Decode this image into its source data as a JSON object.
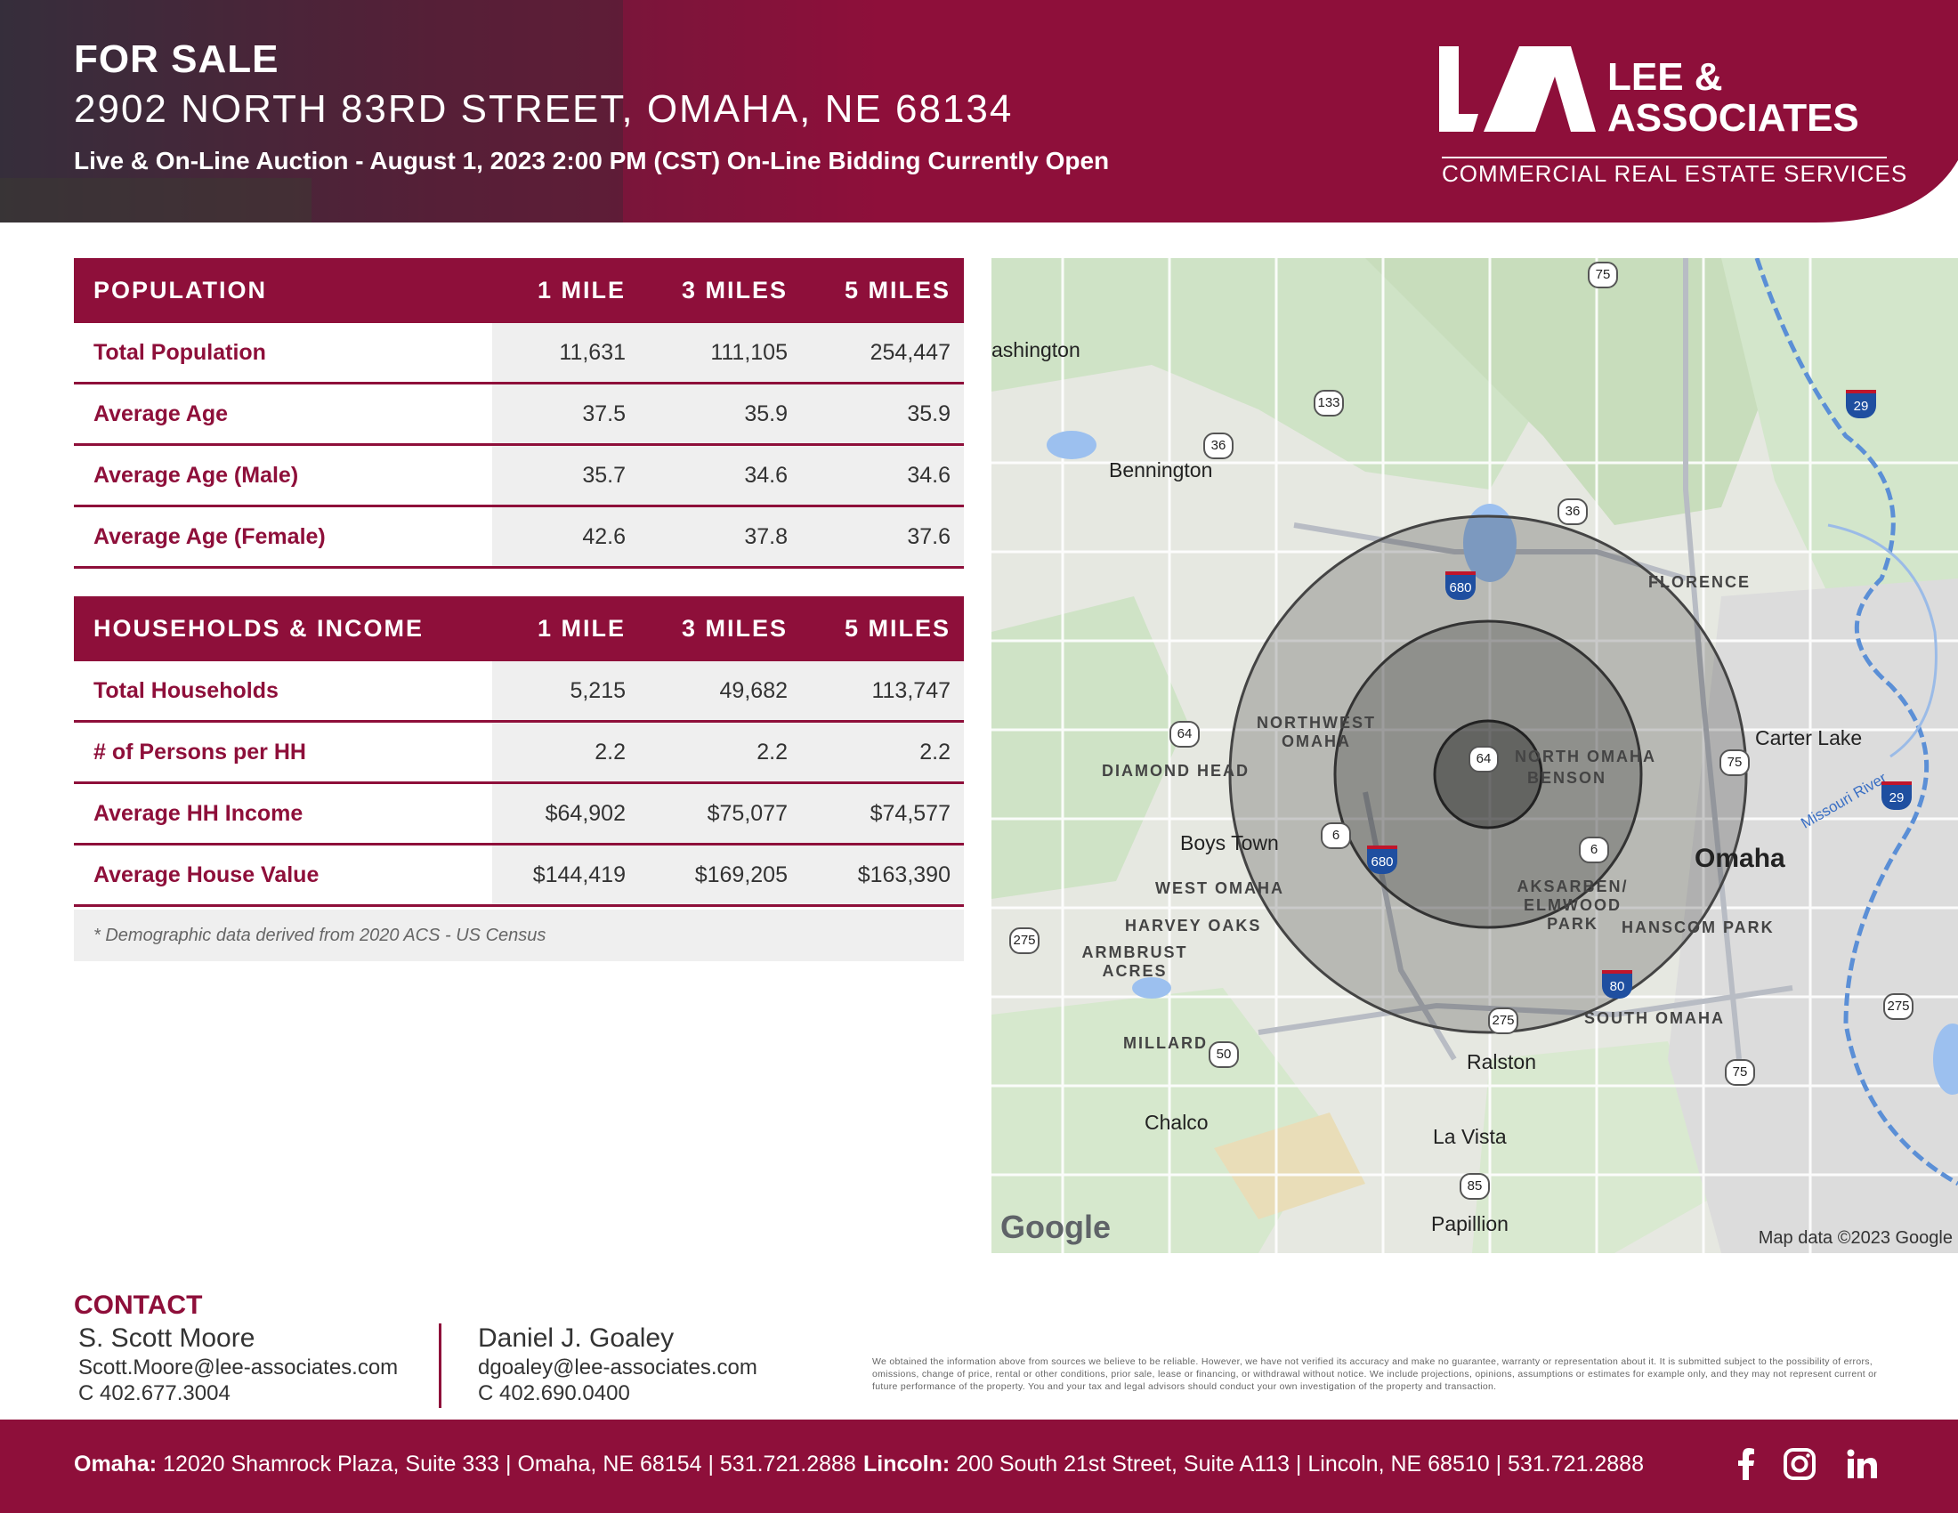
{
  "header": {
    "title": "FOR SALE",
    "address": "2902 NORTH 83RD STREET, OMAHA, NE 68134",
    "subtitle": "Live & On-Line Auction - August 1, 2023 2:00 PM (CST) On-Line Bidding Currently Open"
  },
  "logo": {
    "line1": "LEE &",
    "line2": "ASSOCIATES",
    "tagline": "COMMERCIAL REAL ESTATE SERVICES"
  },
  "population": {
    "heading": "POPULATION",
    "columns": [
      "1 MILE",
      "3 MILES",
      "5 MILES"
    ],
    "rows": [
      {
        "label": "Total Population",
        "values": [
          "11,631",
          "111,105",
          "254,447"
        ]
      },
      {
        "label": "Average Age",
        "values": [
          "37.5",
          "35.9",
          "35.9"
        ]
      },
      {
        "label": "Average Age (Male)",
        "values": [
          "35.7",
          "34.6",
          "34.6"
        ]
      },
      {
        "label": "Average Age (Female)",
        "values": [
          "42.6",
          "37.8",
          "37.6"
        ]
      }
    ]
  },
  "households": {
    "heading": "HOUSEHOLDS & INCOME",
    "columns": [
      "1 MILE",
      "3 MILES",
      "5 MILES"
    ],
    "rows": [
      {
        "label": "Total Households",
        "values": [
          "5,215",
          "49,682",
          "113,747"
        ]
      },
      {
        "label": "# of Persons per HH",
        "values": [
          "2.2",
          "2.2",
          "2.2"
        ]
      },
      {
        "label": "Average HH Income",
        "values": [
          "$64,902",
          "$75,077",
          "$74,577"
        ]
      },
      {
        "label": "Average House Value",
        "values": [
          "$144,419",
          "$169,205",
          "$163,390"
        ]
      }
    ]
  },
  "note": "* Demographic data derived from 2020 ACS - US Census",
  "map": {
    "places": [
      "ashington",
      "Bennington",
      "FLORENCE",
      "NORTHWEST OMAHA",
      "NORTH OMAHA",
      "BENSON",
      "DIAMOND HEAD",
      "Carter Lake",
      "Boys Town",
      "Omaha",
      "WEST OMAHA",
      "AKSARBEN/ ELMWOOD PARK",
      "HANSCOM PARK",
      "HARVEY OAKS",
      "ARMBRUST ACRES",
      "SOUTH OMAHA",
      "MILLARD",
      "Ralston",
      "Chalco",
      "La Vista",
      "Papillion",
      "Missouri River"
    ],
    "routes": [
      "75",
      "133",
      "36",
      "36",
      "29",
      "680",
      "64",
      "64",
      "75",
      "29",
      "6",
      "680",
      "6",
      "275",
      "80",
      "275",
      "275",
      "50",
      "75",
      "85"
    ],
    "attribution": "Map data ©2023 Google",
    "brand": "Google"
  },
  "contact": {
    "title": "CONTACT",
    "people": [
      {
        "name": "S. Scott Moore",
        "email": "Scott.Moore@lee-associates.com",
        "phone": "C  402.677.3004"
      },
      {
        "name": "Daniel J. Goaley",
        "email": "dgoaley@lee-associates.com",
        "phone": "C  402.690.0400"
      }
    ],
    "disclaimer": "We obtained the information above from sources we believe to be reliable. However, we have not verified its accuracy and make no guarantee, warranty or representation about it. It is submitted subject to the possibility of errors, omissions, change of price, rental or other conditions, prior sale, lease or financing, or withdrawal without notice. We include projections, opinions, assumptions or estimates for example only, and they may not represent current or future performance of the property. You and your tax and legal advisors should conduct your own investigation of the property and transaction."
  },
  "footer": {
    "omaha_label": "Omaha:",
    "omaha_text": "12020 Shamrock Plaza, Suite 333  |  Omaha, NE 68154  |  531.721.2888",
    "lincoln_label": "Lincoln:",
    "lincoln_text": "200 South 21st Street, Suite A113  |  Lincoln, NE 68510  |  531.721.2888",
    "social": [
      "facebook-icon",
      "instagram-icon",
      "linkedin-icon"
    ]
  },
  "colors": {
    "brand": "#8e0f3a",
    "row_shade": "#efefef"
  }
}
